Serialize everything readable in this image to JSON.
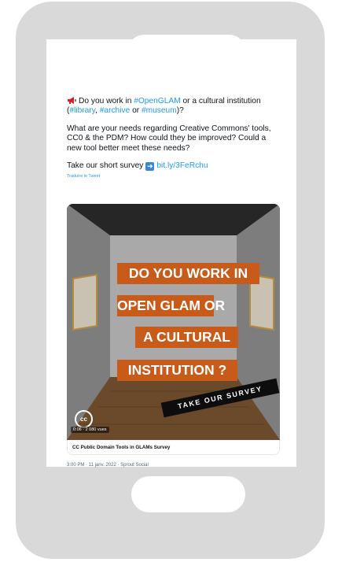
{
  "tweet": {
    "line1_prefix": "Do you work in ",
    "line1_tag": "#OpenGLAM",
    "line1_mid": " or a cultural institution (",
    "tag_library": "#library",
    "sep1": ", ",
    "tag_archive": "#archive",
    "sep2": " or ",
    "tag_museum": "#museum",
    "line1_end": ")?",
    "paragraph2": "What are your needs regarding Creative Commons' tools, CC0 & the PDM? How could they be improved? Could a new tool better meet these needs?",
    "survey_prefix": "Take our short survey",
    "survey_link": "bit.ly/3FeRchu",
    "translate": "Traduire le Tweet"
  },
  "media": {
    "banner1": "DO YOU WORK IN",
    "banner2": "OPEN GLAM OR",
    "banner3": "A CULTURAL",
    "banner4": "INSTITUTION ?",
    "survey_tag": "TAKE OUR SURVEY",
    "cc_logo": "cc",
    "duration": "0:06 · 2 080 vues"
  },
  "card": {
    "title": "CC Public Domain Tools in GLAMs Survey"
  },
  "meta": {
    "timestamp": "3:00 PM · 11 janv. 2022 · Sprout Social"
  },
  "colors": {
    "accent_link": "#1d9bf0",
    "banner_orange": "#c85a1a",
    "phone_frame": "#d9d9d9"
  }
}
